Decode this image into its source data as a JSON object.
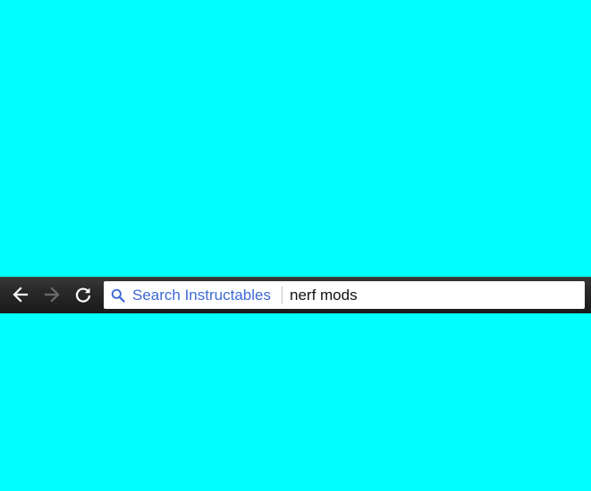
{
  "page": {
    "background_color": "#00ffff"
  },
  "toolbar": {
    "background_color": "#222222",
    "back_icon": "arrow-left-icon",
    "forward_icon": "arrow-right-icon",
    "reload_icon": "reload-icon",
    "forward_enabled": false
  },
  "omnibox": {
    "search_icon": "search-icon",
    "keyword_label": "Search Instructables",
    "keyword_color": "#3d6ad6",
    "query_value": "nerf mods"
  }
}
